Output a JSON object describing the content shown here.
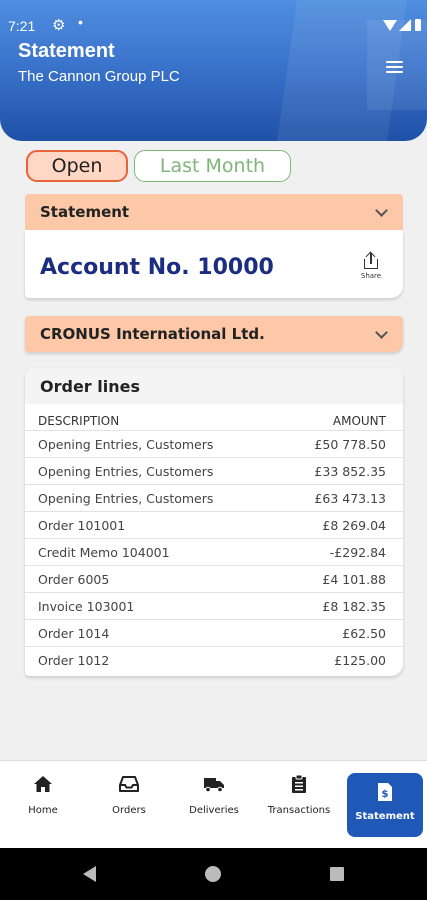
{
  "status_bar": {
    "time": "7:21"
  },
  "header": {
    "title": "Statement",
    "subtitle": "The Cannon Group PLC"
  },
  "filters": [
    {
      "label": "Open",
      "selected": true
    },
    {
      "label": "Last Month",
      "selected": false
    }
  ],
  "statement_section": {
    "title": "Statement",
    "account_label": "Account No. 10000",
    "share_label": "Share"
  },
  "company_section": {
    "title": "CRONUS International Ltd."
  },
  "order_lines": {
    "title": "Order lines",
    "columns": {
      "description": "DESCRIPTION",
      "amount": "AMOUNT"
    },
    "rows": [
      {
        "description": "Opening Entries, Customers",
        "amount": "£50 778.50"
      },
      {
        "description": "Opening Entries, Customers",
        "amount": "£33 852.35"
      },
      {
        "description": "Opening Entries, Customers",
        "amount": "£63 473.13"
      },
      {
        "description": "Order 101001",
        "amount": "£8 269.04"
      },
      {
        "description": "Credit Memo 104001",
        "amount": "-£292.84"
      },
      {
        "description": "Order 6005",
        "amount": "£4 101.88"
      },
      {
        "description": "Invoice 103001",
        "amount": "£8 182.35"
      },
      {
        "description": "Order 1014",
        "amount": "£62.50"
      },
      {
        "description": "Order 1012",
        "amount": "£125.00"
      }
    ]
  },
  "bottom_nav": [
    {
      "label": "Home",
      "icon": "home-icon"
    },
    {
      "label": "Orders",
      "icon": "inbox-icon"
    },
    {
      "label": "Deliveries",
      "icon": "truck-icon"
    },
    {
      "label": "Transactions",
      "icon": "clipboard-icon"
    },
    {
      "label": "Statement",
      "icon": "statement-doc-icon",
      "active": true
    }
  ],
  "colors": {
    "header_blue": "#3b74cc",
    "accent_orange": "#fcc8a8",
    "open_chip_border": "#e8643a",
    "last_month_green": "#7fb77a",
    "account_text": "#1b2d80",
    "active_nav": "#1f58b6"
  }
}
